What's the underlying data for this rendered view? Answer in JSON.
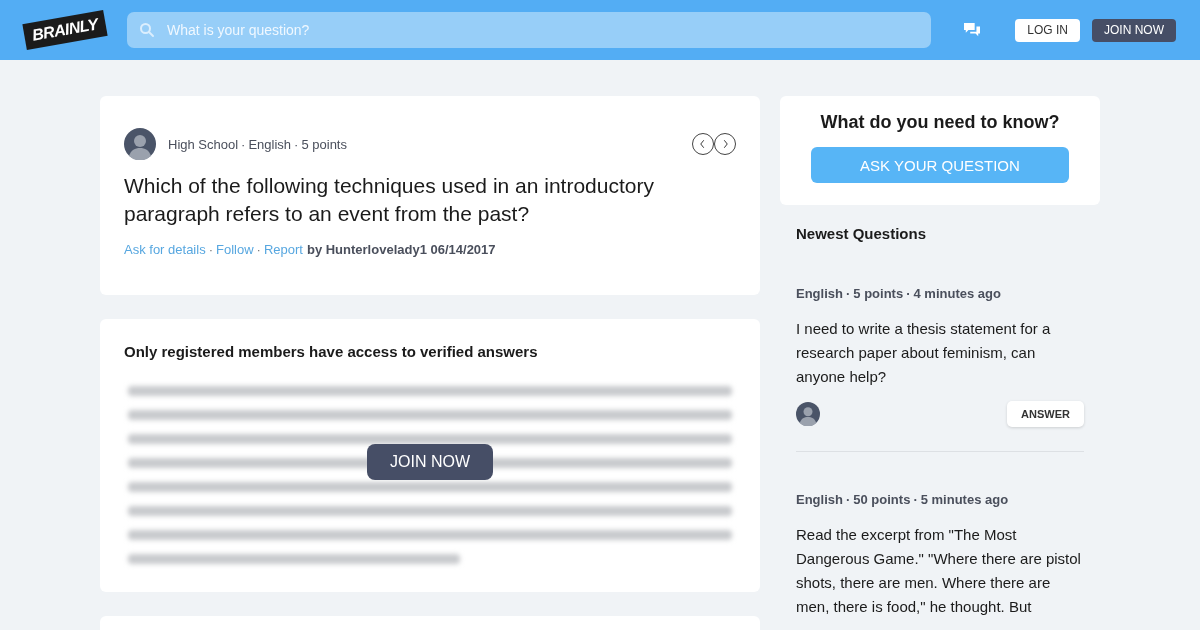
{
  "separator": "·",
  "header": {
    "logo": "BRAINLY",
    "search": {
      "placeholder": "What is your question?"
    },
    "buttons": [
      {
        "label": "LOG IN",
        "kind": "light"
      },
      {
        "label": "JOIN NOW",
        "kind": "dark"
      }
    ]
  },
  "question": {
    "meta": [
      "High School",
      "English",
      "5 points"
    ],
    "title": "Which of the following techniques used in an introductory paragraph refers to an event from the past?",
    "links": [
      "Ask for details",
      "Follow",
      "Report"
    ],
    "author": "by Hunterlovelady1 06/14/2017"
  },
  "answer_card": {
    "heading": "Only registered members have access to verified answers",
    "button": "JOIN NOW"
  },
  "ask_card": {
    "title": "What do you need to know?",
    "button": "ASK YOUR QUESTION"
  },
  "newest": {
    "title": "Newest Questions",
    "items": [
      {
        "meta": [
          "English",
          "5 points",
          "4 minutes ago"
        ],
        "text": "I need to write a thesis statement for a research paper about feminism, can anyone help?",
        "button": "ANSWER"
      },
      {
        "meta": [
          "English",
          "50 points",
          "5 minutes ago"
        ],
        "text": "Read the excerpt from \"The Most Dangerous Game.\" \"Where there are pistol shots, there are men. Where there are men, there is food,\" he thought. But"
      }
    ]
  }
}
